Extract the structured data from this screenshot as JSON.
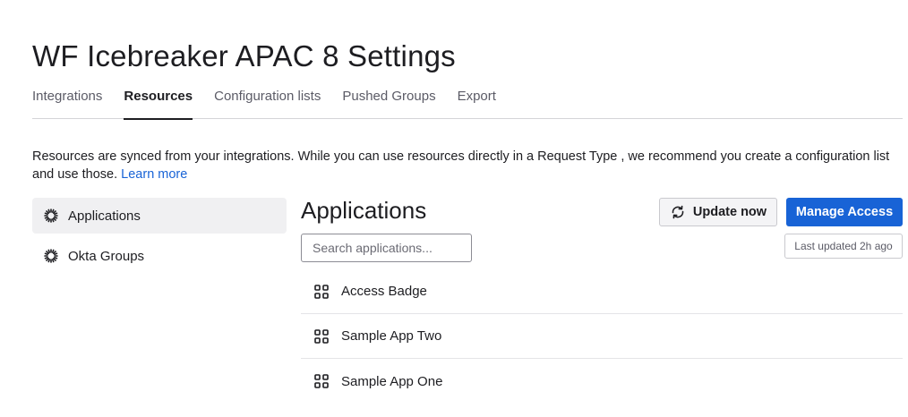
{
  "page": {
    "title": "WF Icebreaker APAC 8 Settings"
  },
  "tabs": [
    {
      "label": "Integrations",
      "active": false
    },
    {
      "label": "Resources",
      "active": true
    },
    {
      "label": "Configuration lists",
      "active": false
    },
    {
      "label": "Pushed Groups",
      "active": false
    },
    {
      "label": "Export",
      "active": false
    }
  ],
  "description": {
    "text": "Resources are synced from your integrations. While you can use resources directly in a Request Type , we recommend you create a configuration list and use those. ",
    "link": "Learn more"
  },
  "sidebar": {
    "items": [
      {
        "label": "Applications",
        "icon": "okta-sunburst-icon",
        "active": true
      },
      {
        "label": "Okta Groups",
        "icon": "okta-sunburst-icon",
        "active": false
      }
    ]
  },
  "main": {
    "title": "Applications",
    "search": {
      "placeholder": "Search applications...",
      "value": ""
    },
    "update_button": {
      "label": "Update now",
      "icon": "sync-icon"
    },
    "manage_button": {
      "label": "Manage Access"
    },
    "last_updated": "Last updated 2h ago",
    "apps": [
      {
        "name": "Access Badge",
        "icon": "app-grid-icon"
      },
      {
        "name": "Sample App Two",
        "icon": "app-grid-icon"
      },
      {
        "name": "Sample App One",
        "icon": "app-grid-icon"
      }
    ]
  },
  "colors": {
    "accent": "#1863d6",
    "text": "#1d1d21",
    "muted": "#5b5b66"
  }
}
